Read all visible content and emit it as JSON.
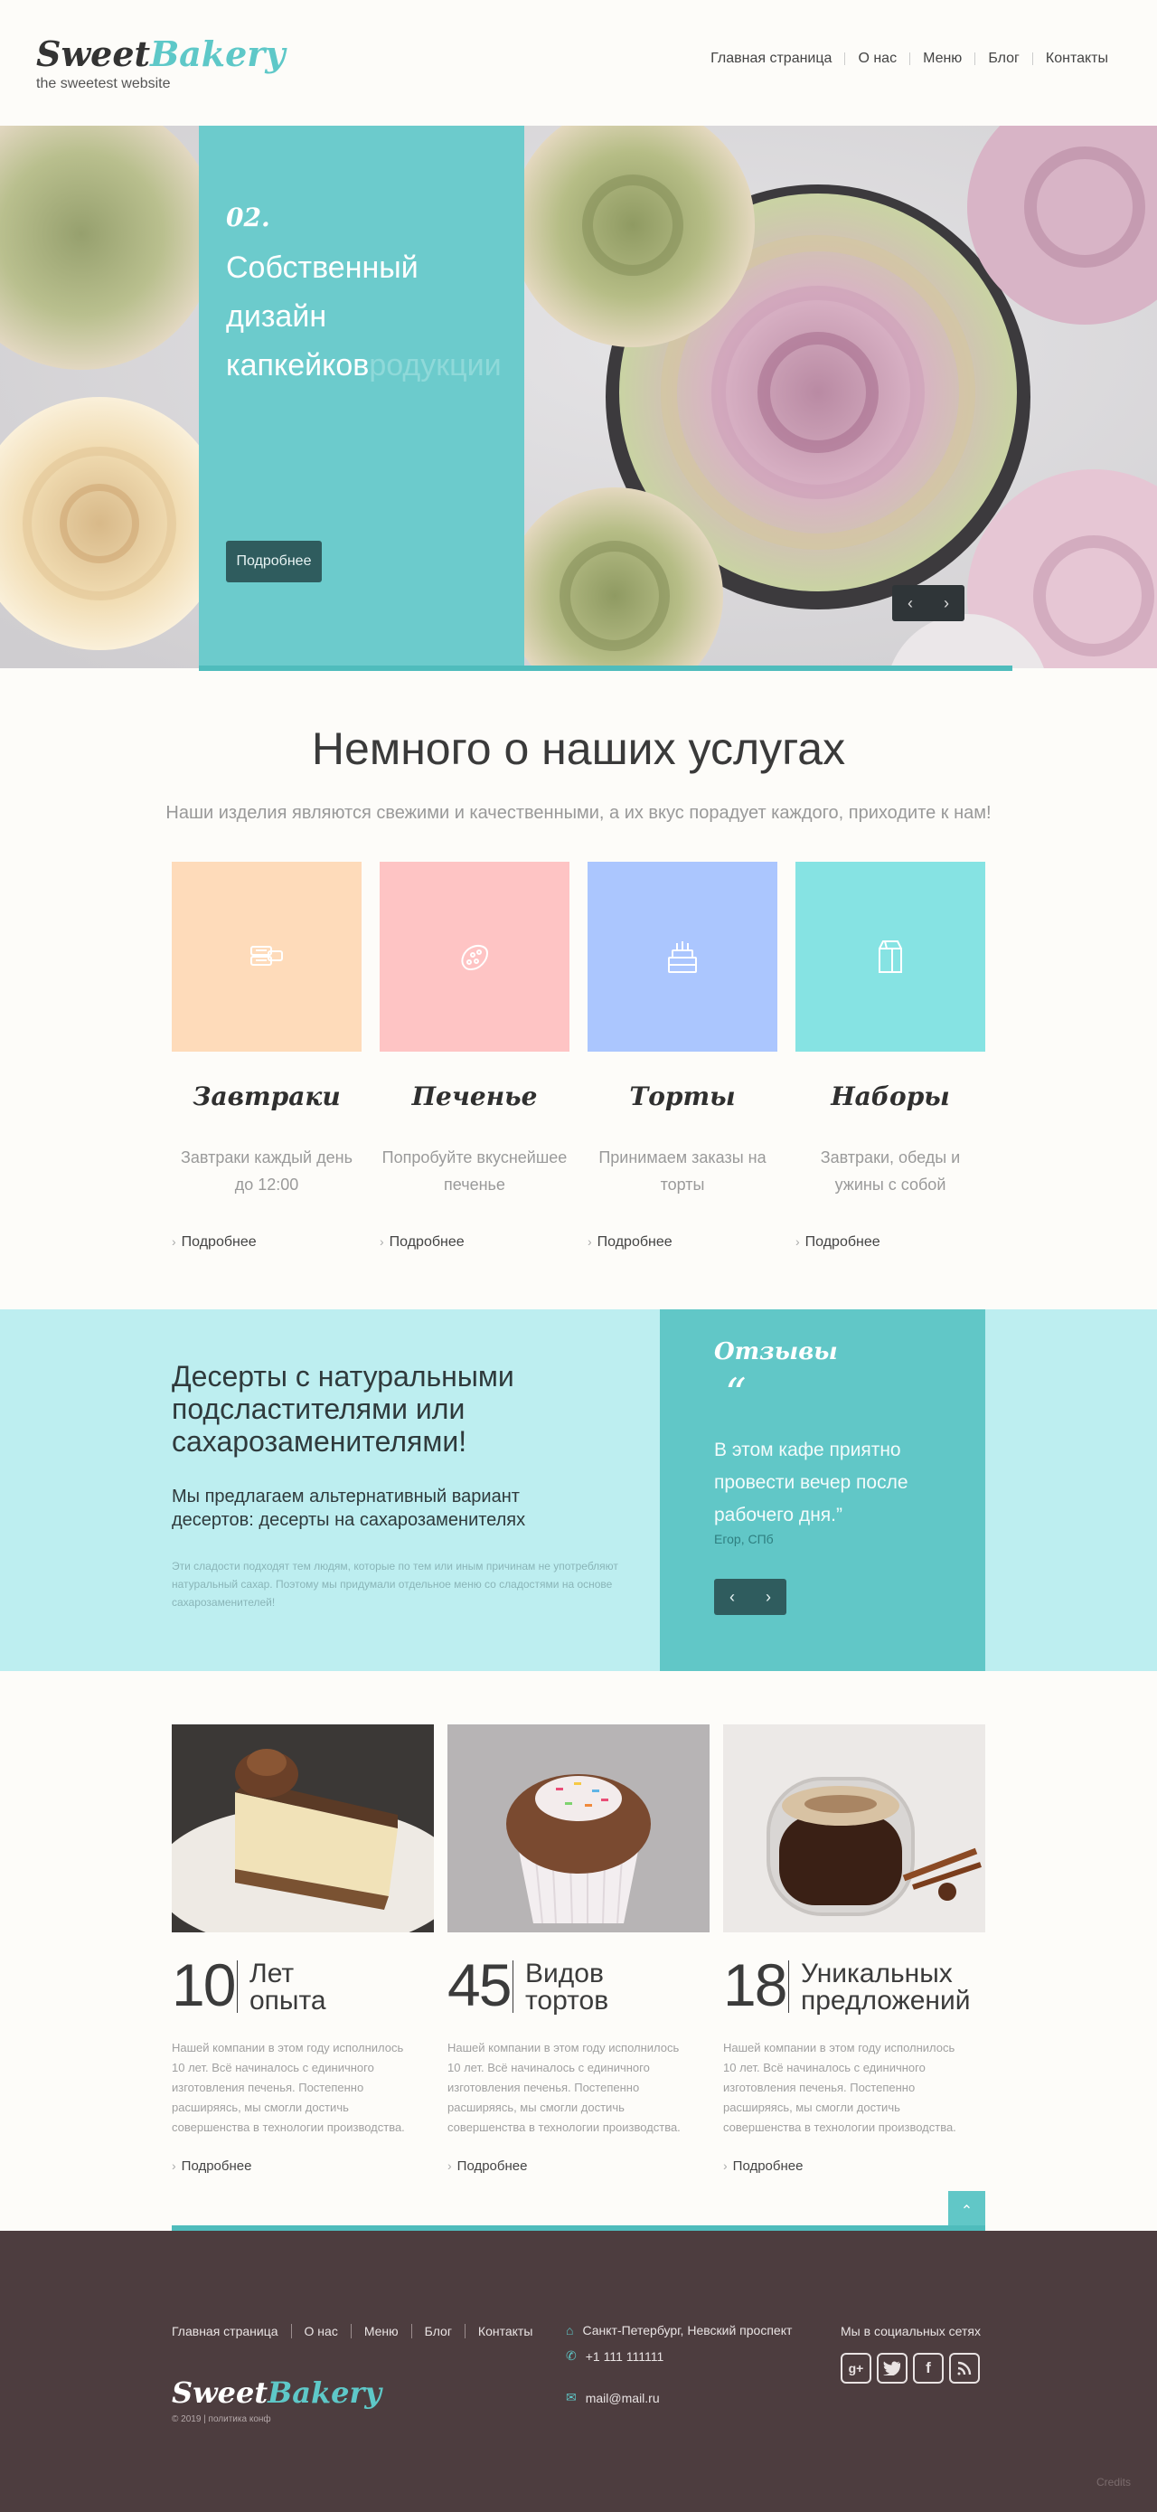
{
  "header": {
    "logo_part1": "Sweet",
    "logo_part2": "Bakery",
    "tagline": "the sweetest website",
    "nav": [
      "Главная страница",
      "О нас",
      "Меню",
      "Блог",
      "Контакты"
    ]
  },
  "hero": {
    "slide_number": "02.",
    "title_line1": "Собственный дизайн",
    "title_line2": "капкейков",
    "title_ghost": "родукции",
    "button": "Подробнее",
    "prev_icon": "chevron-left-icon",
    "next_icon": "chevron-right-icon"
  },
  "services": {
    "title": "Немного о наших услугах",
    "subtitle": "Наши изделия являются свежими и качественными, а их вкус порадует каждого, приходите к нам!",
    "more_label": "Подробнее",
    "items": [
      {
        "title": "Завтраки",
        "desc": "Завтраки каждый день до 12:00",
        "icon": "breakfast-icon",
        "color": "#fedbba"
      },
      {
        "title": "Печенье",
        "desc": "Попробуйте вкуснейшее печенье",
        "icon": "cookie-icon",
        "color": "#fec4c4"
      },
      {
        "title": "Торты",
        "desc": "Принимаем заказы на торты",
        "icon": "cake-icon",
        "color": "#abc6fe"
      },
      {
        "title": "Наборы",
        "desc": "Завтраки, обеды и ужины с собой",
        "icon": "package-icon",
        "color": "#86e3e3"
      }
    ]
  },
  "promo": {
    "heading": "Десерты с натуральными подсластителями или сахарозаменителями!",
    "subheading": "Мы предлагаем альтернативный вариант десертов: десерты на сахарозаменителях",
    "text": "Эти сладости подходят тем людям, которые по тем или иным причинам не употребляют натуральный сахар. Поэтому мы придумали отдельное меню со сладостями на основе сахарозаменителей!"
  },
  "reviews": {
    "title": "Отзывы",
    "quote_mark": "“",
    "quote": "В этом кафе приятно провести вечер после рабочего дня.”",
    "author": "Егор, СПб"
  },
  "stats": {
    "more_label": "Подробнее",
    "desc": "Нашей компании в этом году исполнилось 10 лет. Всё начиналось с единичного изготовления печенья. Постепенно расширяясь, мы смогли достичь совершенства в технологии производства.",
    "items": [
      {
        "number": "10",
        "label1": "Лет",
        "label2": "опыта"
      },
      {
        "number": "45",
        "label1": "Видов",
        "label2": "тортов"
      },
      {
        "number": "18",
        "label1": "Уникальных",
        "label2": "предложений"
      }
    ]
  },
  "footer": {
    "nav": [
      "Главная страница",
      "О нас",
      "Меню",
      "Блог",
      "Контакты"
    ],
    "logo_part1": "Sweet",
    "logo_part2": "Bakery",
    "copyright": "© 2019 | политика конф",
    "address": "Санкт-Петербург, Невский проспект",
    "phone": "+1 111 111111",
    "email": "mail@mail.ru",
    "social_title": "Мы в социальных сетях",
    "social": [
      "google-plus-icon",
      "twitter-icon",
      "facebook-icon",
      "rss-icon"
    ],
    "credits": "Credits"
  }
}
